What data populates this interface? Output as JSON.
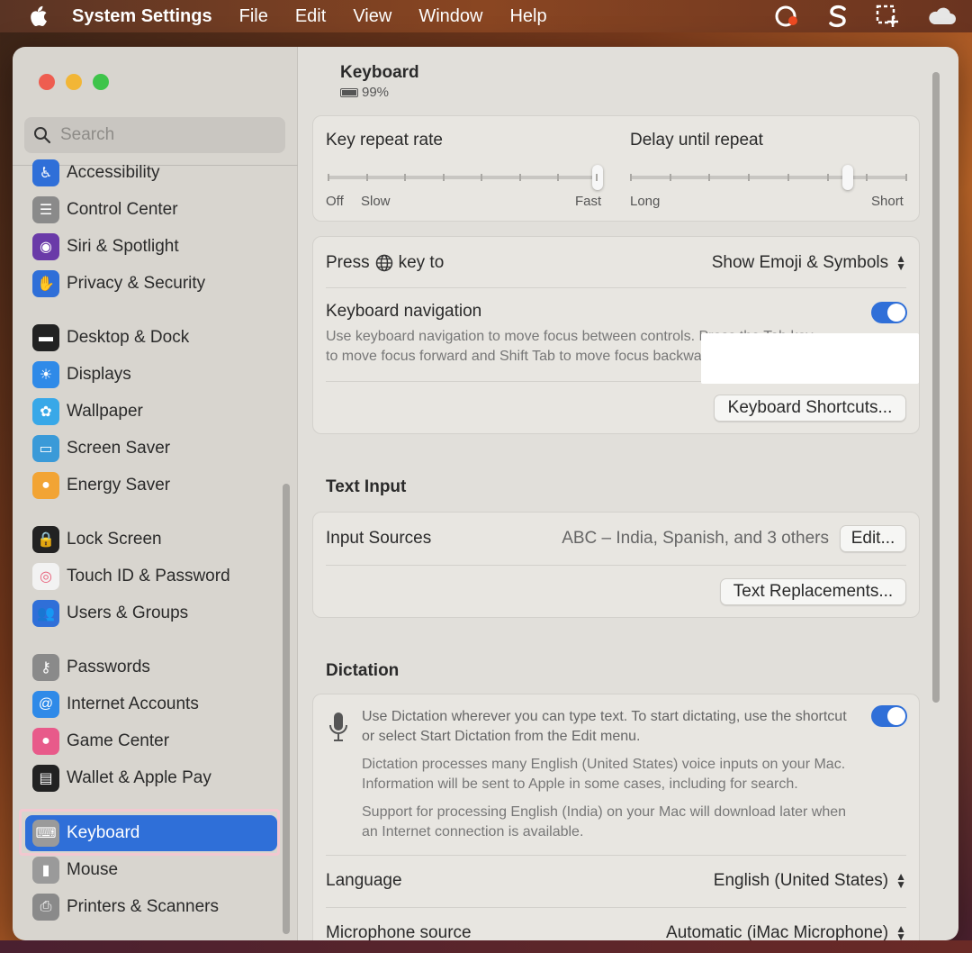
{
  "menubar": {
    "app": "System Settings",
    "items": [
      "File",
      "Edit",
      "View",
      "Window",
      "Help"
    ],
    "icons": [
      "apple-icon",
      "creative-cloud-icon",
      "s-app-icon",
      "screenshot-icon",
      "cloud-icon"
    ]
  },
  "sidebar": {
    "search_placeholder": "Search",
    "items": [
      {
        "label": "Accessibility",
        "icon": "accessibility-icon",
        "color": "#2f6fd8"
      },
      {
        "label": "Control Center",
        "icon": "control-center-icon",
        "color": "#8a8a8a"
      },
      {
        "label": "Siri & Spotlight",
        "icon": "siri-icon",
        "color": "#6a3aa8"
      },
      {
        "label": "Privacy & Security",
        "icon": "hand-icon",
        "color": "#2f6fd8"
      },
      {
        "label": "Desktop & Dock",
        "icon": "dock-icon",
        "color": "#222222"
      },
      {
        "label": "Displays",
        "icon": "sun-icon",
        "color": "#2f8ae8"
      },
      {
        "label": "Wallpaper",
        "icon": "flower-icon",
        "color": "#38a8e8"
      },
      {
        "label": "Screen Saver",
        "icon": "screen-saver-icon",
        "color": "#3a9ad8"
      },
      {
        "label": "Energy Saver",
        "icon": "bulb-icon",
        "color": "#f2a434"
      },
      {
        "label": "Lock Screen",
        "icon": "lock-icon",
        "color": "#222222"
      },
      {
        "label": "Touch ID & Password",
        "icon": "fingerprint-icon",
        "color": "#f2f2f2"
      },
      {
        "label": "Users & Groups",
        "icon": "users-icon",
        "color": "#2f6fd8"
      },
      {
        "label": "Passwords",
        "icon": "key-icon",
        "color": "#8a8a8a"
      },
      {
        "label": "Internet Accounts",
        "icon": "at-icon",
        "color": "#2f8ae8"
      },
      {
        "label": "Game Center",
        "icon": "game-center-icon",
        "color": "#e85a8a"
      },
      {
        "label": "Wallet & Apple Pay",
        "icon": "wallet-icon",
        "color": "#222222"
      },
      {
        "label": "Keyboard",
        "icon": "keyboard-icon",
        "color": "#9a9a9a"
      },
      {
        "label": "Mouse",
        "icon": "mouse-icon",
        "color": "#9a9a9a"
      },
      {
        "label": "Printers & Scanners",
        "icon": "printer-icon",
        "color": "#8a8a8a"
      }
    ],
    "selected": "Keyboard"
  },
  "content": {
    "title": "Keyboard",
    "battery": "99%",
    "key_repeat": {
      "label": "Key repeat rate",
      "left": "Off",
      "mid": "Slow",
      "right": "Fast",
      "value": 1.0
    },
    "delay_repeat": {
      "label": "Delay until repeat",
      "left": "Long",
      "right": "Short",
      "value": 0.8
    },
    "press_key": {
      "prefix": "Press",
      "suffix": "key to",
      "value": "Show Emoji & Symbols"
    },
    "keyboard_nav": {
      "label": "Keyboard navigation",
      "desc1": "Use keyboard navigation to move focus between controls. Press the Tab key",
      "desc2": "to move focus forward and Shift Tab to move focus backward.",
      "on": true
    },
    "shortcuts_button": "Keyboard Shortcuts...",
    "text_input": {
      "title": "Text Input",
      "sources_label": "Input Sources",
      "sources_value": "ABC – India, Spanish, and 3 others",
      "edit_button": "Edit...",
      "replacements_button": "Text Replacements..."
    },
    "dictation": {
      "title": "Dictation",
      "line1": "Use Dictation wherever you can type text. To start dictating, use the shortcut",
      "line2": "or select Start Dictation from the Edit menu.",
      "line3": "Dictation processes many English (United States) voice inputs on your Mac.",
      "line4": "Information will be sent to Apple in some cases, including for search.",
      "line5": "Support for processing English (India) on your Mac will download later when",
      "line6": "an Internet connection is available.",
      "on": true,
      "language_label": "Language",
      "language_value": "English (United States)",
      "mic_label": "Microphone source",
      "mic_value": "Automatic (iMac Microphone)"
    }
  }
}
